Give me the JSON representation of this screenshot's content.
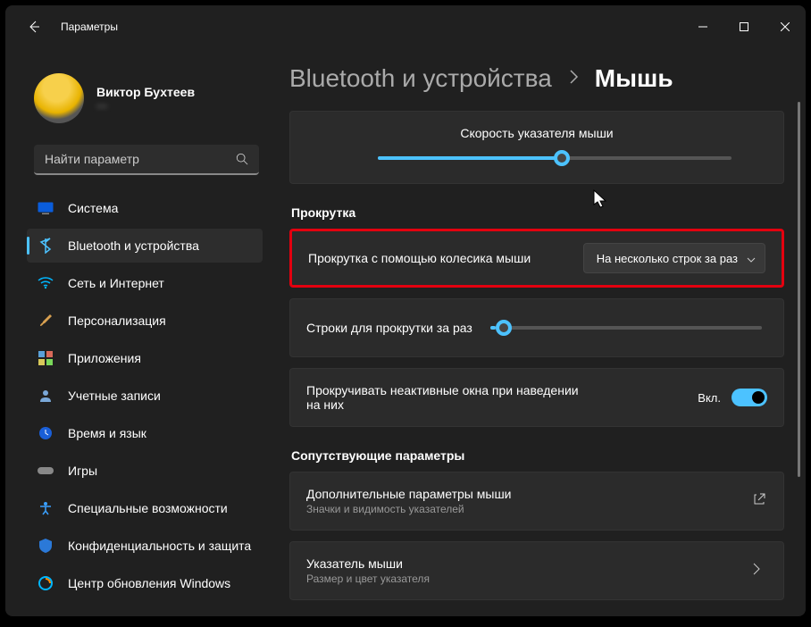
{
  "window": {
    "title": "Параметры"
  },
  "user": {
    "name": "Виктор Бухтеев",
    "email": "—"
  },
  "search": {
    "placeholder": "Найти параметр"
  },
  "sidebar": {
    "items": [
      {
        "label": "Система",
        "icon": "display-icon"
      },
      {
        "label": "Bluetooth и устройства",
        "icon": "bluetooth-icon",
        "selected": true
      },
      {
        "label": "Сеть и Интернет",
        "icon": "wifi-icon"
      },
      {
        "label": "Персонализация",
        "icon": "brush-icon"
      },
      {
        "label": "Приложения",
        "icon": "apps-icon"
      },
      {
        "label": "Учетные записи",
        "icon": "person-icon"
      },
      {
        "label": "Время и язык",
        "icon": "clock-icon"
      },
      {
        "label": "Игры",
        "icon": "gamepad-icon"
      },
      {
        "label": "Специальные возможности",
        "icon": "accessibility-icon"
      },
      {
        "label": "Конфиденциальность и защита",
        "icon": "shield-icon"
      },
      {
        "label": "Центр обновления Windows",
        "icon": "update-icon"
      }
    ]
  },
  "breadcrumb": {
    "l1": "Bluetooth и устройства",
    "l2": "Мышь"
  },
  "main": {
    "speed": {
      "title": "Скорость указателя мыши",
      "value_pct": 52
    },
    "section_scroll": "Прокрутка",
    "wheel_scroll": {
      "label": "Прокрутка с помощью колесика мыши",
      "value": "На несколько строк за раз"
    },
    "lines": {
      "label": "Строки для прокрутки за раз",
      "value_pct": 4
    },
    "inactive": {
      "label": "Прокручивать неактивные окна при наведении на них",
      "state": "Вкл."
    },
    "section_related": "Сопутствующие параметры",
    "adv": {
      "title": "Дополнительные параметры мыши",
      "sub": "Значки и видимость указателей"
    },
    "pointer": {
      "title": "Указатель мыши",
      "sub": "Размер и цвет указателя"
    }
  }
}
